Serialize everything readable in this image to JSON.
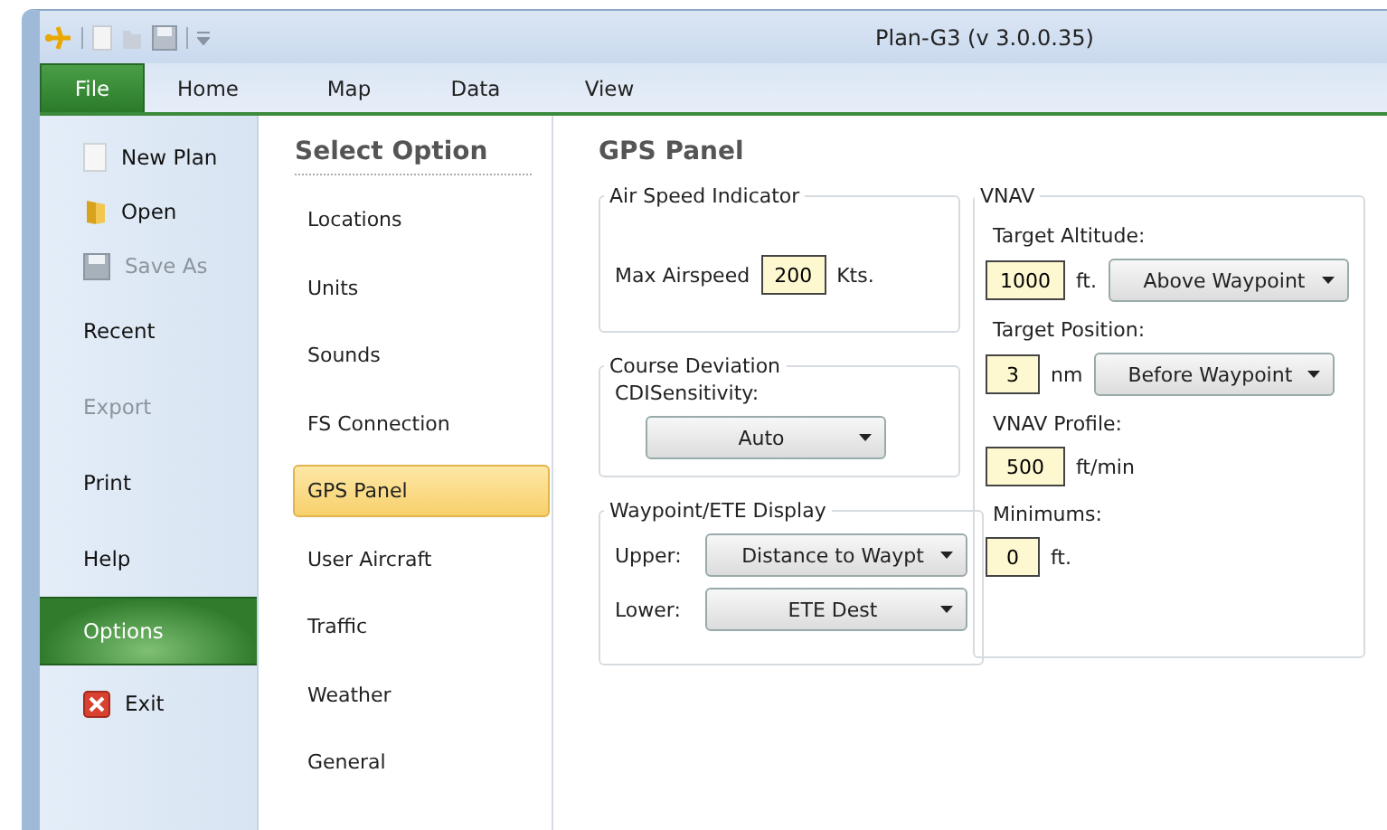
{
  "window": {
    "title": "Plan-G3 (v 3.0.0.35)"
  },
  "ribbon_tabs": [
    {
      "label": "File",
      "selected": true
    },
    {
      "label": "Home",
      "selected": false
    },
    {
      "label": "Map",
      "selected": false
    },
    {
      "label": "Data",
      "selected": false
    },
    {
      "label": "View",
      "selected": false
    }
  ],
  "file_menu": [
    {
      "label": "New Plan",
      "kind": "new",
      "disabled": false,
      "selected": false
    },
    {
      "label": "Open",
      "kind": "open",
      "disabled": false,
      "selected": false
    },
    {
      "label": "Save As",
      "kind": "save",
      "disabled": true,
      "selected": false
    },
    {
      "label": "Recent",
      "kind": "text",
      "disabled": false,
      "selected": false
    },
    {
      "label": "Export",
      "kind": "text",
      "disabled": true,
      "selected": false
    },
    {
      "label": "Print",
      "kind": "text",
      "disabled": false,
      "selected": false
    },
    {
      "label": "Help",
      "kind": "text",
      "disabled": false,
      "selected": false
    },
    {
      "label": "Options",
      "kind": "text",
      "disabled": false,
      "selected": true
    },
    {
      "label": "Exit",
      "kind": "exit",
      "disabled": false,
      "selected": false
    }
  ],
  "options": {
    "heading": "Select Option",
    "items": [
      {
        "label": "Locations",
        "selected": false
      },
      {
        "label": "Units",
        "selected": false
      },
      {
        "label": "Sounds",
        "selected": false
      },
      {
        "label": "FS Connection",
        "selected": false
      },
      {
        "label": "GPS Panel",
        "selected": true
      },
      {
        "label": "User Aircraft",
        "selected": false
      },
      {
        "label": "Traffic",
        "selected": false
      },
      {
        "label": "Weather",
        "selected": false
      },
      {
        "label": "General",
        "selected": false
      }
    ]
  },
  "panel": {
    "title": "GPS Panel",
    "air_speed": {
      "legend": "Air Speed Indicator",
      "label": "Max Airspeed",
      "value": "200",
      "unit": "Kts."
    },
    "course_deviation": {
      "legend": "Course Deviation",
      "label": "CDISensitivity:",
      "dropdown": "Auto"
    },
    "waypoint_display": {
      "legend": "Waypoint/ETE Display",
      "rows": [
        {
          "label": "Upper:",
          "dropdown": "Distance to Waypt"
        },
        {
          "label": "Lower:",
          "dropdown": "ETE Dest"
        }
      ]
    },
    "vnav": {
      "legend": "VNAV",
      "fields": [
        {
          "label": "Target Altitude:",
          "value": "1000",
          "unit": "ft.",
          "dropdown": "Above Waypoint"
        },
        {
          "label": "Target Position:",
          "value": "3",
          "unit": "nm",
          "dropdown": "Before Waypoint"
        },
        {
          "label": "VNAV Profile:",
          "value": "500",
          "unit": "ft/min"
        },
        {
          "label": "Minimums:",
          "value": "0",
          "unit": "ft."
        }
      ]
    }
  }
}
